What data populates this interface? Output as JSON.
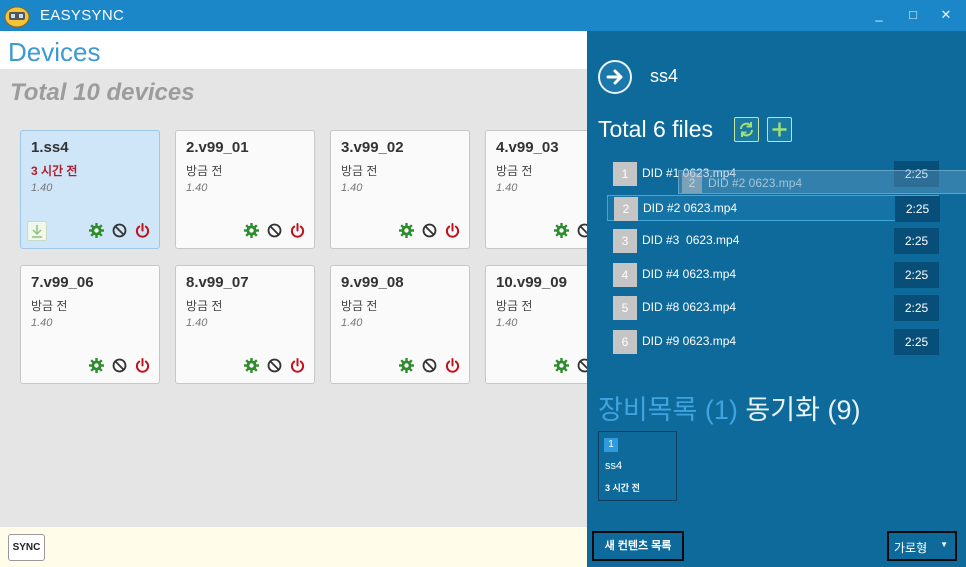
{
  "window": {
    "title": "EASYSYNC",
    "controls": {
      "minimize": "_",
      "maximize": "□",
      "close": "✕"
    }
  },
  "devices_panel": {
    "page_title": "Devices",
    "total_label": "Total 10 devices",
    "devices": [
      {
        "name": "1.ss4",
        "status": "3 시간 전",
        "version": "1.40"
      },
      {
        "name": "2.v99_01",
        "status": "방금 전",
        "version": "1.40"
      },
      {
        "name": "3.v99_02",
        "status": "방금 전",
        "version": "1.40"
      },
      {
        "name": "4.v99_03",
        "status": "방금 전",
        "version": "1.40"
      },
      {
        "name": "7.v99_06",
        "status": "방금 전",
        "version": "1.40"
      },
      {
        "name": "8.v99_07",
        "status": "방금 전",
        "version": "1.40"
      },
      {
        "name": "9.v99_08",
        "status": "방금 전",
        "version": "1.40"
      },
      {
        "name": "10.v99_09",
        "status": "방금 전",
        "version": "1.40"
      }
    ],
    "sync_button": "SYNC",
    "icons": {
      "settings": "gear-icon",
      "disable": "block-icon",
      "power": "power-icon",
      "download": "download-icon"
    },
    "colors": {
      "settings": "#2e8b2e",
      "disable": "#333333",
      "power": "#c0131e",
      "selected_card": "#cfe6f8"
    }
  },
  "files_panel": {
    "device_name": "ss4",
    "total_label": "Total 6 files",
    "files": [
      {
        "num": "1",
        "name": "DID #1 0623.mp4",
        "duration": "2:25"
      },
      {
        "num": "2",
        "name": "DID #2 0623.mp4",
        "duration": "2:25"
      },
      {
        "num": "3",
        "name": "DID #3  0623.mp4",
        "duration": "2:25"
      },
      {
        "num": "4",
        "name": "DID #4 0623.mp4",
        "duration": "2:25"
      },
      {
        "num": "5",
        "name": "DID #8 0623.mp4",
        "duration": "2:25"
      },
      {
        "num": "6",
        "name": "DID #9 0623.mp4",
        "duration": "2:25"
      }
    ],
    "drag_ghost": {
      "num": "2",
      "name": "DID #2 0623.mp4"
    },
    "heading_list": "장비목록",
    "heading_list_count": "(1)",
    "heading_sync": "동기화",
    "heading_sync_count": "(9)",
    "sync_device": {
      "num": "1",
      "name": "ss4",
      "time": "3 시간 전"
    },
    "new_content_button": "새 컨텐츠 목록",
    "orientation": {
      "selected": "가로형"
    },
    "colors": {
      "panel": "#0e6a9a",
      "duration_bg": "#074e79",
      "accent": "#3fa3df"
    }
  }
}
